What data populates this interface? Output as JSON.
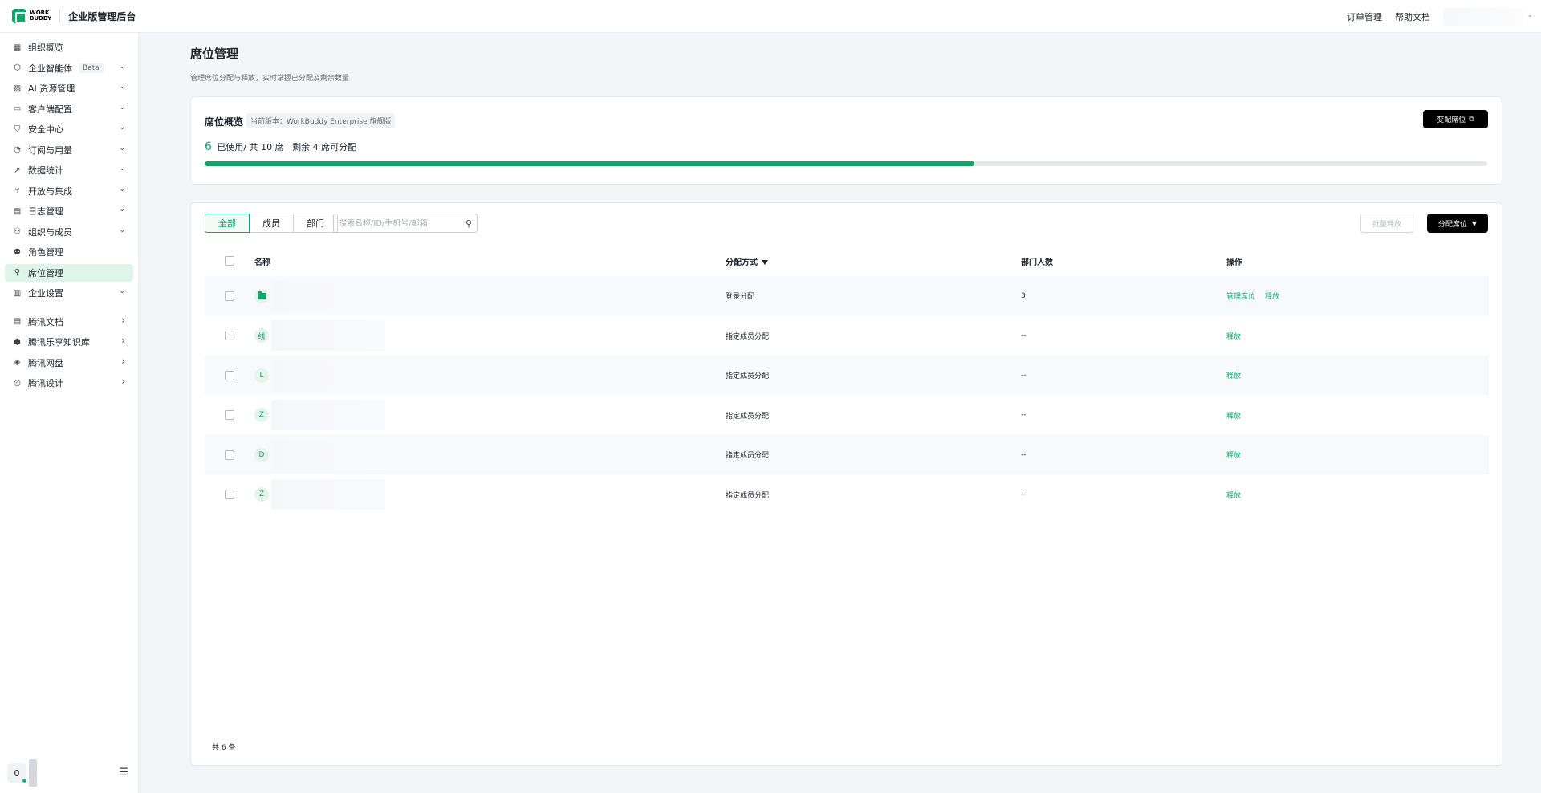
{
  "app": {
    "logo_line1": "WORK",
    "logo_line2": "BUDDY",
    "title": "企业版管理后台",
    "top_links": [
      "订单管理",
      "帮助文档"
    ]
  },
  "sidebar": {
    "items": [
      {
        "label": "组织概览",
        "icon": "grid-icon",
        "chevron": ""
      },
      {
        "label": "企业智能体",
        "icon": "agent-icon",
        "chevron": "down",
        "badge": "Beta"
      },
      {
        "label": "AI 资源管理",
        "icon": "image-icon",
        "chevron": "down"
      },
      {
        "label": "客户端配置",
        "icon": "window-icon",
        "chevron": "down"
      },
      {
        "label": "安全中心",
        "icon": "shield-icon",
        "chevron": "down"
      },
      {
        "label": "订阅与用量",
        "icon": "pie-icon",
        "chevron": "down"
      },
      {
        "label": "数据统计",
        "icon": "chart-icon",
        "chevron": "down"
      },
      {
        "label": "开放与集成",
        "icon": "integration-icon",
        "chevron": "down"
      },
      {
        "label": "日志管理",
        "icon": "log-icon",
        "chevron": "down"
      },
      {
        "label": "组织与成员",
        "icon": "team-icon",
        "chevron": "down"
      },
      {
        "label": "角色管理",
        "icon": "role-icon",
        "chevron": ""
      },
      {
        "label": "席位管理",
        "icon": "seat-icon",
        "chevron": "",
        "active": true
      },
      {
        "label": "企业设置",
        "icon": "settings-icon",
        "chevron": "down"
      }
    ],
    "external": [
      {
        "label": "腾讯文档",
        "icon": "doc-icon"
      },
      {
        "label": "腾讯乐享知识库",
        "icon": "knowledge-icon"
      },
      {
        "label": "腾讯网盘",
        "icon": "drive-icon"
      },
      {
        "label": "腾讯设计",
        "icon": "design-icon"
      }
    ],
    "user_initial": "0"
  },
  "page": {
    "title": "席位管理",
    "description": "管理席位分配与释放，实时掌握已分配及剩余数量"
  },
  "overview": {
    "title": "席位概览",
    "tag": "当前版本：WorkBuddy Enterprise 旗舰版",
    "used": "6",
    "used_text": "已使用/ 共 10 席",
    "remaining_text": "剩余 4 席可分配",
    "used_fraction": 0.6,
    "change_button": "变配席位"
  },
  "table": {
    "tabs": [
      "全部",
      "成员",
      "部门"
    ],
    "active_tab": 0,
    "search_placeholder": "搜索名称/ID/手机号/邮箱",
    "batch_button": "批量释放",
    "assign_button": "分配席位",
    "headers": {
      "name": "名称",
      "mode": "分配方式",
      "count": "部门人数",
      "op": "操作"
    },
    "rows": [
      {
        "avatar": "",
        "type": "folder",
        "mode": "登录分配",
        "count": "3",
        "ops": [
          "管理席位",
          "释放"
        ]
      },
      {
        "avatar": "线",
        "type": "user",
        "mode": "指定成员分配",
        "count": "--",
        "ops": [
          "释放"
        ]
      },
      {
        "avatar": "L",
        "type": "user",
        "mode": "指定成员分配",
        "count": "--",
        "ops": [
          "释放"
        ]
      },
      {
        "avatar": "Z",
        "type": "user",
        "mode": "指定成员分配",
        "count": "--",
        "ops": [
          "释放"
        ]
      },
      {
        "avatar": "D",
        "type": "user",
        "mode": "指定成员分配",
        "count": "--",
        "ops": [
          "释放"
        ]
      },
      {
        "avatar": "Z",
        "type": "user",
        "mode": "指定成员分配",
        "count": "--",
        "ops": [
          "释放"
        ]
      }
    ],
    "total": "共 6 条"
  },
  "colors": {
    "accent": "#11a66a",
    "active_bg": "#dff5ec"
  }
}
